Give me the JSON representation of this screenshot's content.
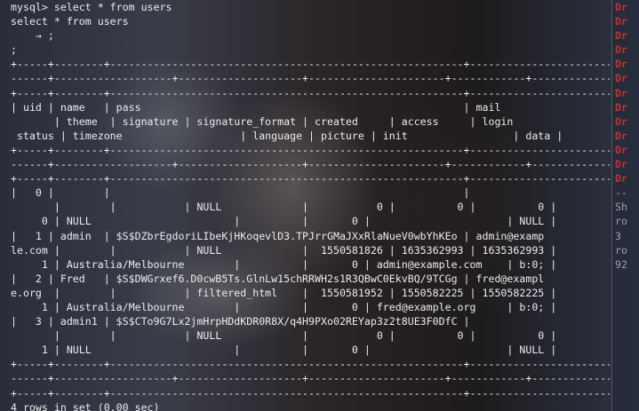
{
  "terminal": {
    "lines": [
      "mysql> select * from users",
      "select * from users",
      "    → ;",
      ";",
      "+-----+--------+---------------------------------------------------------+-----------------------",
      "------+-------------------+--------------------+----------------------+------------+-------------",
      "+-----+--------+---------------------------------------------------------+-----------------------",
      "| uid | name   | pass                                                    | mail",
      "       | theme  | signature | signature_format | created     | access     | login",
      " status | timezone                   | language | picture | init                 | data |",
      "+-----+--------+---------------------------------------------------------+-----------------------",
      "------+-------------------+--------------------+----------------------+------------+-------------",
      "+-----+--------+---------------------------------------------------------+-----------------------",
      "|   0 |        |                                                         |",
      "       |        |           | NULL             |           0 |          0 |          0 |",
      "     0 | NULL                       |          |       0 |                      | NULL |",
      "|   1 | admin  | $S$DZbrEgdoriLIbeKjHKoqevlD3.TPJrrGMaJXxRlaNueV0wbYhKEo | admin@examp",
      "le.com |        |           | NULL             |  1550581826 | 1635362993 | 1635362993 |",
      "     1 | Australia/Melbourne        |          |       0 | admin@example.com    | b:0; |",
      "|   2 | Fred   | $S$DWGrxef6.D0cwB5Ts.GlnLw15chRRWH2s1R3QBwC0EkvBQ/9TCGg | fred@exampl",
      "e.org  |        |           | filtered_html    |  1550581952 | 1550582225 | 1550582225 |",
      "     1 | Australia/Melbourne        |          |       0 | fred@example.org     | b:0; |",
      "|   3 | admin1 | $S$CTo9G7Lx2jmHrpHDdKDR0R8X/q4H9PXo02REYap3z2t8UE3F0DfC |",
      "       |        |           | NULL             |           0 |          0 |          0 |",
      "     1 | NULL                       |          |       0 |                      | NULL |",
      "+-----+--------+---------------------------------------------------------+-----------------------",
      "------+-------------------+--------------------+----------------------+------------+-------------",
      "+-----+--------+---------------------------------------------------------+-----------------------",
      "4 rows in set (0.00 sec)"
    ]
  },
  "side_pane": {
    "lines": [
      {
        "text": "Dr",
        "style": "drop"
      },
      {
        "text": "Dr",
        "style": "drop"
      },
      {
        "text": "Dr",
        "style": "drop"
      },
      {
        "text": "Dr",
        "style": "drop"
      },
      {
        "text": "Dr",
        "style": "drop"
      },
      {
        "text": "Dr",
        "style": "drop"
      },
      {
        "text": "Dr",
        "style": "drop"
      },
      {
        "text": "Dr",
        "style": "drop"
      },
      {
        "text": "Dr",
        "style": "drop"
      },
      {
        "text": "Dr",
        "style": "drop"
      },
      {
        "text": "Dr",
        "style": "drop"
      },
      {
        "text": "Dr",
        "style": "drop"
      },
      {
        "text": "Dr",
        "style": "drop"
      },
      {
        "text": "--",
        "style": "dim"
      },
      {
        "text": "Sh",
        "style": "dim"
      },
      {
        "text": "ro",
        "style": "dim"
      },
      {
        "text": "3",
        "style": "dim"
      },
      {
        "text": "ro",
        "style": "dim"
      },
      {
        "text": "92",
        "style": "dim"
      }
    ]
  }
}
